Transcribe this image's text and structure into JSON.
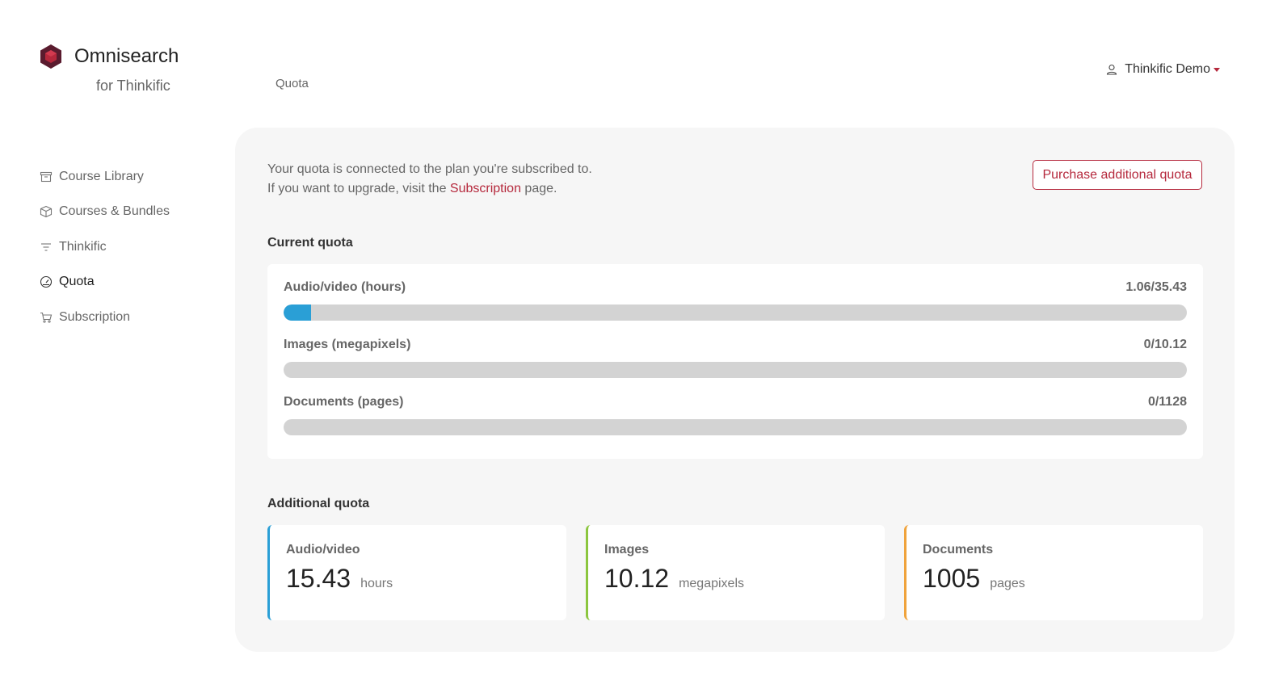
{
  "brand": {
    "name": "Omnisearch",
    "subtitle": "for Thinkific",
    "logo_colors": [
      "#5a1b2e",
      "#b5283c"
    ]
  },
  "breadcrumb": "Quota",
  "user": {
    "name": "Thinkific Demo",
    "icon": "user-icon"
  },
  "sidebar": {
    "items": [
      {
        "label": "Course Library",
        "icon": "archive-icon",
        "active": false
      },
      {
        "label": "Courses & Bundles",
        "icon": "box-icon",
        "active": false
      },
      {
        "label": "Thinkific",
        "icon": "filter-icon",
        "active": false
      },
      {
        "label": "Quota",
        "icon": "gauge-icon",
        "active": true
      },
      {
        "label": "Subscription",
        "icon": "cart-icon",
        "active": false
      }
    ]
  },
  "main": {
    "intro_line1": "Your quota is connected to the plan you're subscribed to.",
    "intro_line2_prefix": "If you want to upgrade, visit the",
    "intro_link": "Subscription",
    "intro_line2_suffix": "page.",
    "purchase_button": "Purchase additional quota",
    "current_title": "Current quota",
    "current": [
      {
        "label": "Audio/video (hours)",
        "value": "1.06/35.43",
        "fraction": 0.03
      },
      {
        "label": "Images (megapixels)",
        "value": "0/10.12",
        "fraction": 0
      },
      {
        "label": "Documents (pages)",
        "value": "0/1128",
        "fraction": 0
      }
    ],
    "additional_title": "Additional quota",
    "additional": [
      {
        "title": "Audio/video",
        "value": "15.43",
        "unit": "hours",
        "accent": "#2a9fd6"
      },
      {
        "title": "Images",
        "value": "10.12",
        "unit": "megapixels",
        "accent": "#8cc63f"
      },
      {
        "title": "Documents",
        "value": "1005",
        "unit": "pages",
        "accent": "#f0a33c"
      }
    ]
  },
  "colors": {
    "accent": "#b5283c",
    "progress": "#2a9fd6",
    "panel_bg": "#f6f6f6"
  }
}
